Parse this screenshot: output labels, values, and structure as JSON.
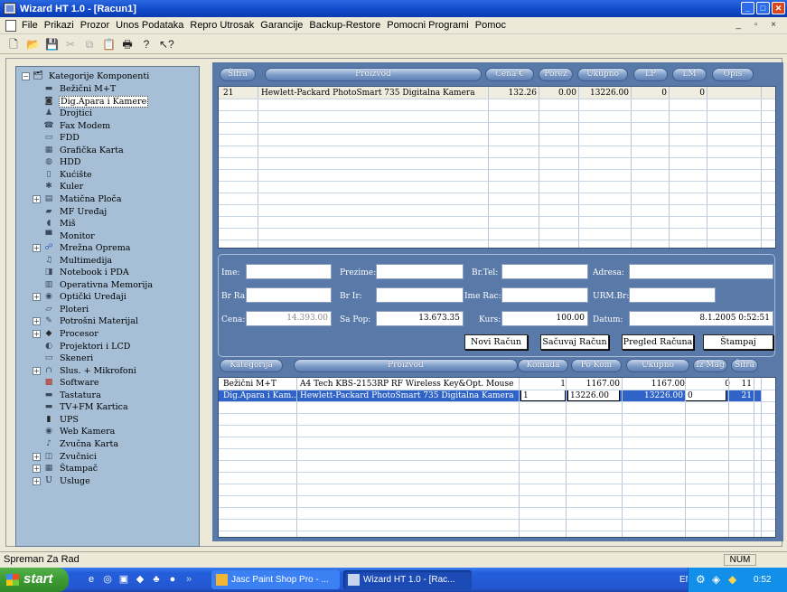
{
  "window": {
    "title": "Wizard HT 1.0 - [Racun1]",
    "min": "_",
    "max": "□",
    "close": "✕"
  },
  "menu": [
    "File",
    "Prikazi",
    "Prozor",
    "Unos Podataka",
    "Repro Utrosak",
    "Garancije",
    "Backup-Restore",
    "Pomocni Programi",
    "Pomoc"
  ],
  "mdi_controls": "_ ▫ ×",
  "toolbar_icons": [
    "new-icon",
    "open-icon",
    "save-icon",
    "cut-icon",
    "copy-icon",
    "paste-icon",
    "print-icon",
    "help-icon",
    "context-help-icon"
  ],
  "tree": {
    "root": "Kategorije Komponenti",
    "items": [
      {
        "label": "Bežični M+T",
        "icon": "keyboard-icon",
        "expander": ""
      },
      {
        "label": "Dig.Apara i Kamere",
        "icon": "camera-icon",
        "expander": "",
        "selected": true
      },
      {
        "label": "Drojtici",
        "icon": "joystick-icon",
        "expander": ""
      },
      {
        "label": "Fax Modem",
        "icon": "modem-icon",
        "expander": ""
      },
      {
        "label": "FDD",
        "icon": "floppy-icon",
        "expander": ""
      },
      {
        "label": "Grafička Karta",
        "icon": "graphics-card-icon",
        "expander": ""
      },
      {
        "label": "HDD",
        "icon": "hdd-icon",
        "expander": ""
      },
      {
        "label": "Kućište",
        "icon": "case-icon",
        "expander": ""
      },
      {
        "label": "Kuler",
        "icon": "cooler-icon",
        "expander": ""
      },
      {
        "label": "Matična Ploča",
        "icon": "motherboard-icon",
        "expander": "+"
      },
      {
        "label": "MF Uređaj",
        "icon": "mf-device-icon",
        "expander": ""
      },
      {
        "label": "Miš",
        "icon": "mouse-icon",
        "expander": ""
      },
      {
        "label": "Monitor",
        "icon": "monitor-icon",
        "expander": ""
      },
      {
        "label": "Mrežna Oprema",
        "icon": "network-icon",
        "expander": "+"
      },
      {
        "label": "Multimedija",
        "icon": "multimedia-icon",
        "expander": ""
      },
      {
        "label": "Notebook i PDA",
        "icon": "notebook-icon",
        "expander": ""
      },
      {
        "label": "Operativna Memorija",
        "icon": "memory-icon",
        "expander": ""
      },
      {
        "label": "Optički Uređaji",
        "icon": "optical-drive-icon",
        "expander": "+"
      },
      {
        "label": "Ploteri",
        "icon": "plotter-icon",
        "expander": ""
      },
      {
        "label": "Potrošni Materijal",
        "icon": "consumables-icon",
        "expander": "+"
      },
      {
        "label": "Procesor",
        "icon": "cpu-icon",
        "expander": "+"
      },
      {
        "label": "Projektori i LCD",
        "icon": "projector-icon",
        "expander": ""
      },
      {
        "label": "Skeneri",
        "icon": "scanner-icon",
        "expander": ""
      },
      {
        "label": "Slus. + Mikrofoni",
        "icon": "headset-icon",
        "expander": "+"
      },
      {
        "label": "Software",
        "icon": "software-icon",
        "expander": ""
      },
      {
        "label": "Tastatura",
        "icon": "keyboard-icon",
        "expander": ""
      },
      {
        "label": "TV+FM Kartica",
        "icon": "tv-card-icon",
        "expander": ""
      },
      {
        "label": "UPS",
        "icon": "ups-icon",
        "expander": ""
      },
      {
        "label": "Web Kamera",
        "icon": "webcam-icon",
        "expander": ""
      },
      {
        "label": "Zvučna Karta",
        "icon": "sound-card-icon",
        "expander": ""
      },
      {
        "label": "Zvučnici",
        "icon": "speakers-icon",
        "expander": "+"
      },
      {
        "label": "Štampač",
        "icon": "printer-icon",
        "expander": "+"
      },
      {
        "label": "Usluge",
        "icon": "services-icon",
        "expander": "+"
      }
    ]
  },
  "top_grid": {
    "headers": [
      "Šifra",
      "Proizvod",
      "Cena €",
      "Porez",
      "Ukupno",
      "LP",
      "LM",
      "Opis"
    ],
    "rows": [
      [
        "21",
        "Hewlett-Packard PhotoSmart 735 Digitalna Kamera",
        "132.26",
        "0.00",
        "13226.00",
        "0",
        "0",
        ""
      ]
    ]
  },
  "form": {
    "ime_label": "Ime:",
    "ime": "",
    "prezime_label": "Prezime:",
    "prezime": "",
    "brtel_label": "Br.Tel:",
    "brtel": "",
    "adresa_label": "Adresa:",
    "adresa": "",
    "brra_label": "Br Ra:",
    "brra": "",
    "brir_label": "Br Ir:",
    "brir": "",
    "imerac_label": "Ime Rac:",
    "imerac": "",
    "urmbr_label": "URM.Br:",
    "urmbr": "",
    "cena_label": "Cena:",
    "cena": "14.393.00",
    "sapop_label": "Sa Pop:",
    "sapop": "13.673.35",
    "kurs_label": "Kurs:",
    "kurs": "100.00",
    "datum_label": "Datum:",
    "datum": "8.1.2005 0:52:51",
    "btn_novi": "Novi Račun",
    "btn_sacuvaj": "Sačuvaj Račun",
    "btn_pregled": "Pregled Računa",
    "btn_stampaj": "Štampaj"
  },
  "bottom_grid": {
    "headers": [
      "Kategorija",
      "Proizvod",
      "Komada",
      "Po Kom",
      "Ukupno",
      "Iz Mag",
      "Šifra"
    ],
    "rows": [
      [
        "Bežični M+T",
        "A4 Tech KBS-2153RP RF Wireless Key&Opt. Mouse ...",
        "1",
        "1167.00",
        "1167.00",
        "0",
        "11"
      ],
      [
        "Dig.Apara i Kam...",
        "Hewlett-Packard PhotoSmart 735 Digitalna Kamera",
        "1",
        "13226.00",
        "13226.00",
        "0",
        "21"
      ]
    ]
  },
  "status": {
    "text": "Spreman Za Rad",
    "num": "NUM"
  },
  "taskbar": {
    "start": "start",
    "tasks": [
      "Jasc Paint Shop Pro - ...",
      "Wizard HT 1.0 - [Rac..."
    ],
    "lang": "EN",
    "clock": "0:52"
  }
}
